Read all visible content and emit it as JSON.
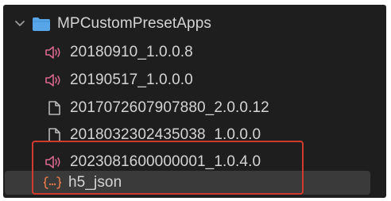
{
  "tree": {
    "folder": {
      "label": "MPCustomPresetApps",
      "icon": "folder-icon",
      "expanded": true
    },
    "items": [
      {
        "label": "20180910_1.0.0.8",
        "icon": "audio-icon"
      },
      {
        "label": "20190517_1.0.0.0",
        "icon": "audio-icon"
      },
      {
        "label": "2017072607907880_2.0.0.12",
        "icon": "file-icon"
      },
      {
        "label": "2018032302435038_1.0.0.0",
        "icon": "file-icon"
      },
      {
        "label": "2023081600000001_1.0.4.0",
        "icon": "audio-icon"
      },
      {
        "label": "h5_json",
        "icon": "json-icon"
      }
    ]
  },
  "colors": {
    "panel_bg": "#1e1e1e",
    "selected_bg": "#3a3a3a",
    "folder_blue": "#58a6e8",
    "audio_pink": "#d9678c",
    "json_orange": "#e0774a",
    "highlight_red": "#d13a2f",
    "text": "#d4d4d4"
  }
}
